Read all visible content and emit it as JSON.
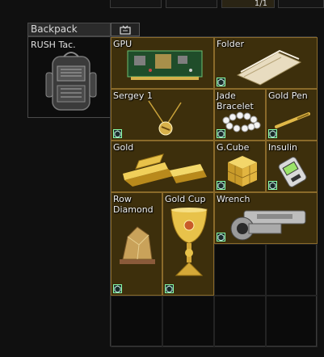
{
  "top_bar": {
    "stack_count": "1/1"
  },
  "backpack": {
    "header_label": "Backpack",
    "item_name": "RUSH Tac."
  },
  "items": [
    {
      "name": "GPU"
    },
    {
      "name": "Folder"
    },
    {
      "name": "Sergey 1"
    },
    {
      "name": "Jade Bracelet"
    },
    {
      "name": "Gold Pen"
    },
    {
      "name": "Gold"
    },
    {
      "name": "G.Cube"
    },
    {
      "name": "Insulin"
    },
    {
      "name": "Row Diamond"
    },
    {
      "name": "Gold Cup"
    },
    {
      "name": "Wrench"
    }
  ],
  "colors": {
    "item_bg": "#3d2f0c",
    "item_border": "#8a6a2a",
    "grid_bg": "#0b0b0b"
  },
  "icons": {
    "examined_corner": "examined-icon",
    "backpack_button": "sort-icon"
  }
}
